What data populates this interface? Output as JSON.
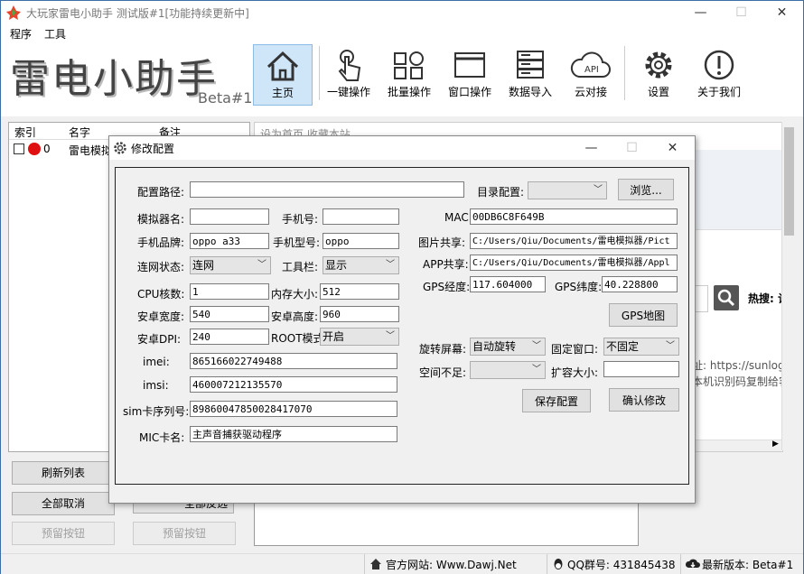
{
  "window": {
    "title": "大玩家雷电小助手 测试版#1[功能持续更新中]",
    "min": "—",
    "max": "☐",
    "close": "✕"
  },
  "menu": [
    "程序",
    "工具"
  ],
  "logo": {
    "text": "雷电小助手",
    "sub": "Beta#1"
  },
  "toolbar": [
    {
      "label": "主页",
      "icon": "home-icon"
    },
    {
      "label": "一键操作",
      "icon": "tap-icon"
    },
    {
      "label": "批量操作",
      "icon": "grid-icon"
    },
    {
      "label": "窗口操作",
      "icon": "window-icon"
    },
    {
      "label": "数据导入",
      "icon": "server-icon"
    },
    {
      "label": "云对接",
      "icon": "cloud-api-icon"
    },
    {
      "label": "设置",
      "icon": "gear-icon"
    },
    {
      "label": "关于我们",
      "icon": "info-icon"
    }
  ],
  "cloud_icon_text": "API",
  "list": {
    "headers": [
      "索引",
      "名字",
      "备注"
    ],
    "rows": [
      {
        "index": "0",
        "name": "雷电模拟"
      }
    ]
  },
  "left_buttons": {
    "refresh": "刷新列表",
    "deselect": "全部取消",
    "select_all": "全部反选",
    "reserve1": "预留按钮",
    "reserve2": "预留按钮"
  },
  "right": {
    "top_links": "设为首页  收藏本站",
    "hot": "热搜: 让",
    "url": "址: https://sunlogin",
    "hint": "本机识别码复制给客"
  },
  "status": {
    "site": "官方网站: Www.Dawj.Net",
    "qq": "QQ群号: 431845438",
    "ver": "最新版本: Beta#1"
  },
  "dialog": {
    "title": "修改配置",
    "config_path_label": "配置路径:",
    "config_path": "",
    "dir_config_label": "目录配置:",
    "dir_config": "",
    "browse": "浏览...",
    "emu_name_label": "模拟器名:",
    "emu_name": "",
    "phone_label": "手机号:",
    "phone": "",
    "mac_label": "MAC:",
    "mac": "00DB6C8F649B",
    "brand_label": "手机品牌:",
    "brand": "oppo a33",
    "model_label": "手机型号:",
    "model": "oppo",
    "pic_share_label": "图片共享:",
    "pic_share": "C:/Users/Qiu/Documents/雷电模拟器/Pict",
    "net_label": "连网状态:",
    "net": "连网",
    "toolbar_label": "工具栏:",
    "toolbar_val": "显示",
    "app_share_label": "APP共享:",
    "app_share": "C:/Users/Qiu/Documents/雷电模拟器/Appl",
    "cpu_label": "CPU核数:",
    "cpu": "1",
    "mem_label": "内存大小:",
    "mem": "512",
    "gps_lon_label": "GPS经度:",
    "gps_lon": "117.604000",
    "gps_lat_label": "GPS纬度:",
    "gps_lat": "40.228800",
    "width_label": "安卓宽度:",
    "width": "540",
    "height_label": "安卓高度:",
    "height": "960",
    "gps_map": "GPS地图",
    "dpi_label": "安卓DPI:",
    "dpi": "240",
    "root_label": "ROOT模式:",
    "root": "开启",
    "rotate_label": "旋转屏幕:",
    "rotate": "自动旋转",
    "fixwin_label": "固定窗口:",
    "fixwin": "不固定",
    "imei_label": "imei:",
    "imei": "865166022749488",
    "space_label": "空间不足:",
    "space": "",
    "expand_label": "扩容大小:",
    "expand": "",
    "imsi_label": "imsi:",
    "imsi": "460007212135570",
    "save": "保存配置",
    "confirm": "确认修改",
    "sim_label": "sim卡序列号:",
    "sim": "89860047850028417070",
    "mic_label": "MIC卡名:",
    "mic": "主声音捕获驱动程序"
  }
}
